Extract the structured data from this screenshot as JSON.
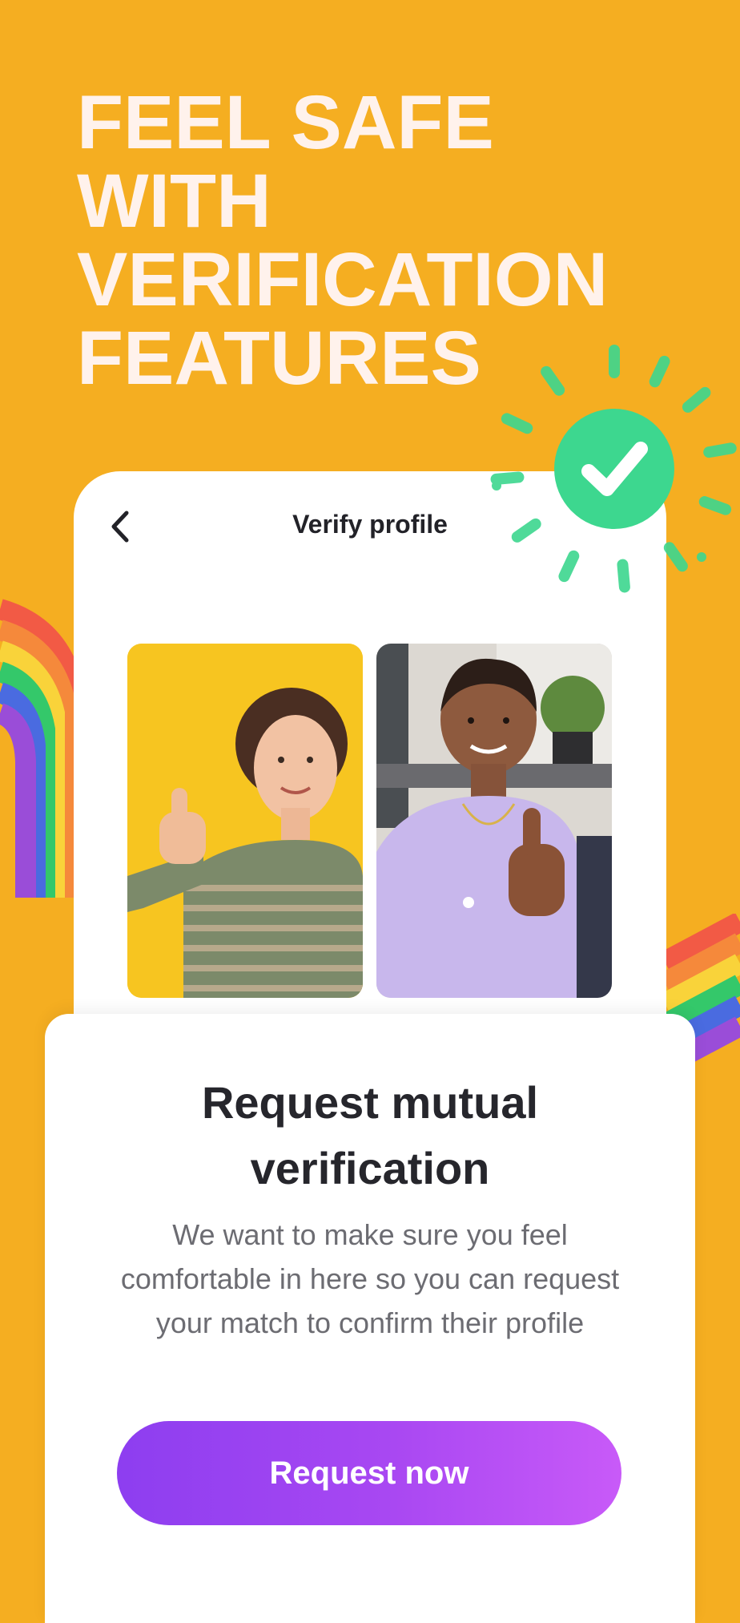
{
  "headline": {
    "lines": [
      "FEEL SAFE",
      "WITH",
      "VERIFICATION",
      "FEATURES"
    ]
  },
  "screen": {
    "title": "Verify profile",
    "back_icon": "chevron-left-icon"
  },
  "badge": {
    "icon": "check-icon",
    "color": "#3DD78F"
  },
  "photos": [
    {
      "name": "verified-photo-woman-thumbs-up-yellow",
      "background": "#F7C520"
    },
    {
      "name": "verified-photo-woman-thumbs-up-office",
      "background": "#D9D7D3"
    }
  ],
  "sheet": {
    "title": "Request mutual verification",
    "body": "We want to make sure you feel comfortable in here so you can request your match to confirm their profile",
    "button_label": "Request now"
  },
  "colors": {
    "background": "#F5AE21",
    "button_start": "#8D3EF0",
    "button_end": "#C85AF8"
  }
}
